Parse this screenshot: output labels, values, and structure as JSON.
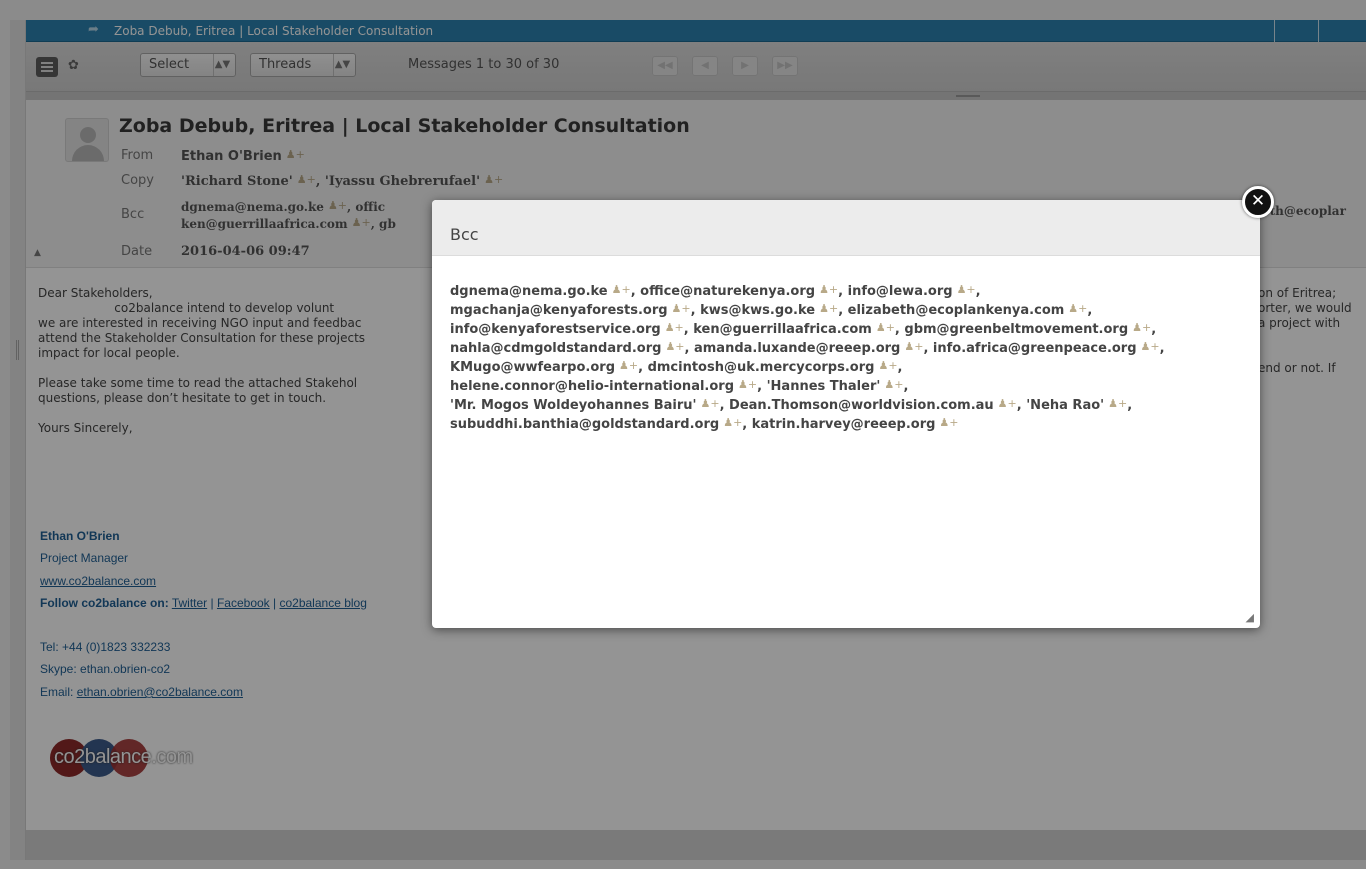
{
  "window": {
    "title": "Zoba Debub, Eritrea | Local Stakeholder Consultation"
  },
  "toolbar": {
    "select_label": "Select",
    "threads_label": "Threads",
    "message_count": "Messages 1 to 30 of 30"
  },
  "message": {
    "subject": "Zoba Debub, Eritrea | Local Stakeholder Consultation",
    "from_label": "From",
    "from_value": "Ethan O'Brien",
    "copy_label": "Copy",
    "copy_value_1": "'Richard Stone'",
    "copy_value_2": "'Iyassu Ghebrerufael'",
    "bcc_label": "Bcc",
    "bcc_line1": "dgnema@nema.go.ke",
    "bcc_line1_b": "offic",
    "bcc_line2": "ken@guerrillaafrica.com",
    "bcc_line2_b": "gb",
    "bcc_right_clip": "eth@ecoplar",
    "date_label": "Date",
    "date_value": "2016-04-06 09:47",
    "body": [
      "Dear Stakeholders,",
      "                    co2balance intend to develop volunt",
      "we are interested in receiving NGO input and feedbac",
      "attend the Stakeholder Consultation for these projects",
      "impact for local people.",
      "",
      "Please take some time to read the attached Stakehol",
      "questions, please don’t hesitate to get in touch.",
      "",
      "Yours Sincerely,"
    ],
    "body_right": [
      "on of Eritrea;",
      "orter, we would",
      "a project with",
      "",
      "",
      "end or not. If"
    ]
  },
  "signature": {
    "name": "Ethan O'Brien",
    "title": "Project Manager",
    "website": "www.co2balance.com",
    "follow_label": "Follow co2balance on:",
    "twitter": "Twitter",
    "facebook": "Facebook",
    "blog": "co2balance blog",
    "sep": "|",
    "tel": "Tel: +44 (0)1823 332233",
    "skype": "Skype: ethan.obrien-co2",
    "email_label": "Email:",
    "email": "ethan.obrien@co2balance.com",
    "logo_text": "co2balance.com"
  },
  "dialog": {
    "title": "Bcc",
    "recipients": [
      "dgnema@nema.go.ke",
      "office@naturekenya.org",
      "info@lewa.org",
      "mgachanja@kenyaforests.org",
      "kws@kws.go.ke",
      "elizabeth@ecoplankenya.com",
      "info@kenyaforestservice.org",
      "ken@guerrillaafrica.com",
      "gbm@greenbeltmovement.org",
      "nahla@cdmgoldstandard.org",
      "amanda.luxande@reeep.org",
      "info.africa@greenpeace.org",
      "KMugo@wwfearpo.org",
      "dmcintosh@uk.mercycorps.org",
      "helene.connor@helio-international.org",
      "'Hannes Thaler'",
      "'Mr. Mogos Woldeyohannes Bairu'",
      "Dean.Thomson@worldvision.com.au",
      "'Neha Rao'",
      "subuddhi.banthia@goldstandard.org",
      "katrin.harvey@reeep.org"
    ],
    "lines": [
      [
        0,
        1,
        2
      ],
      [
        3,
        4,
        5
      ],
      [
        6,
        7,
        8
      ],
      [
        9,
        10,
        11
      ],
      [
        12,
        13
      ],
      [
        14,
        15
      ],
      [
        16,
        17,
        18
      ],
      [
        19,
        20
      ]
    ]
  },
  "icons": {
    "add_contact": "add-contact-icon",
    "close": "close-icon",
    "list_view": "list-view-icon",
    "threads": "threads-icon",
    "nav_first": "first-page-icon",
    "nav_prev": "prev-page-icon",
    "nav_next": "next-page-icon",
    "nav_last": "last-page-icon"
  },
  "colors": {
    "titlebar": "#2b82b0",
    "link": "#1f5f94",
    "overlay": "rgba(0,0,0,0.42)"
  }
}
